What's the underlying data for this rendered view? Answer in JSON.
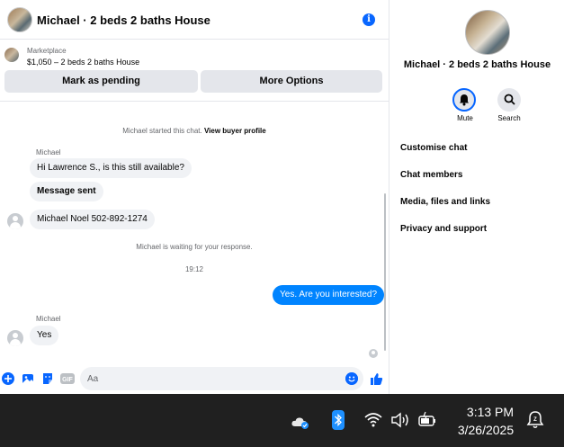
{
  "chat": {
    "title": "Michael · 2 beds 2 baths House",
    "marketplace_label": "Marketplace",
    "listing": "$1,050 – 2 beds 2 baths House",
    "mark_pending_label": "Mark as pending",
    "more_options_label": "More Options",
    "started_text": "Michael started this chat.",
    "view_profile_label": "View buyer profile",
    "sender_1": "Michael",
    "msg_1": "Hi Lawrence S., is this still available?",
    "msg_2": "Message sent",
    "msg_3": "Michael Noel  502-892-1274",
    "waiting_text": "Michael is waiting for your response.",
    "time_stamp": "19:12",
    "msg_out": "Yes. Are you interested?",
    "sender_2": "Michael",
    "msg_4": "Yes",
    "composer_placeholder": "Aa"
  },
  "side": {
    "name": "Michael · 2 beds 2 baths House",
    "mute_label": "Mute",
    "search_label": "Search",
    "menu": [
      "Customise chat",
      "Chat members",
      "Media, files and links",
      "Privacy and support"
    ]
  },
  "taskbar": {
    "time": "3:13 PM",
    "date": "3/26/2025"
  },
  "colors": {
    "accent": "#0866ff",
    "outgoing_bubble": "#0084ff",
    "incoming_bubble": "#f0f2f5",
    "button_bg": "#e4e6eb",
    "taskbar": "#202020"
  }
}
